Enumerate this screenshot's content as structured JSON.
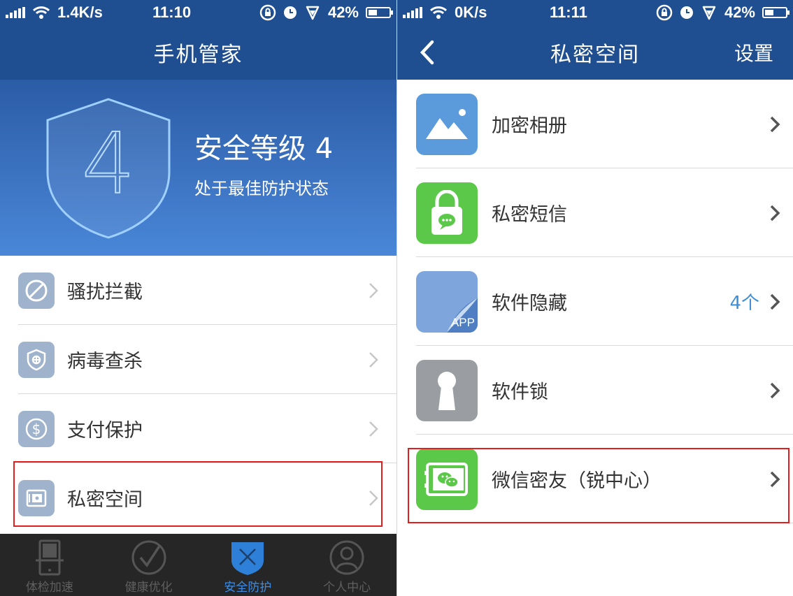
{
  "left": {
    "status": {
      "net_speed": "1.4K/s",
      "time": "11:10",
      "battery": "42%",
      "battery_level": 0.42
    },
    "nav": {
      "title": "手机管家"
    },
    "hero": {
      "digit": "4",
      "title": "安全等级 4",
      "subtitle": "处于最佳防护状态"
    },
    "items": [
      {
        "label": "骚扰拦截",
        "icon": "block-icon"
      },
      {
        "label": "病毒查杀",
        "icon": "virus-shield-icon"
      },
      {
        "label": "支付保护",
        "icon": "dollar-coin-icon"
      },
      {
        "label": "私密空间",
        "icon": "safe-box-icon",
        "highlighted": true
      }
    ],
    "tabs": [
      {
        "label": "体检加速",
        "icon": "phone-check-icon",
        "active": false
      },
      {
        "label": "健康优化",
        "icon": "checkmark-circle-icon",
        "active": false
      },
      {
        "label": "安全防护",
        "icon": "shield-x-icon",
        "active": true
      },
      {
        "label": "个人中心",
        "icon": "user-icon",
        "active": false
      }
    ]
  },
  "right": {
    "status": {
      "net_speed": "0K/s",
      "time": "11:11",
      "battery": "42%",
      "battery_level": 0.42
    },
    "nav": {
      "title": "私密空间",
      "action": "设置"
    },
    "items": [
      {
        "label": "加密相册",
        "icon": "photo-album-icon",
        "color": "#5b9bdc",
        "badge": ""
      },
      {
        "label": "私密短信",
        "icon": "lock-message-icon",
        "color": "#5cc84a",
        "badge": ""
      },
      {
        "label": "软件隐藏",
        "icon": "app-hide-icon",
        "color": "#7ea6dc",
        "badge": "4个",
        "icon_text": "APP"
      },
      {
        "label": "软件锁",
        "icon": "keyhole-icon",
        "color": "#9a9ea3",
        "badge": ""
      },
      {
        "label": "微信密友（锐中心）",
        "icon": "wechat-safe-icon",
        "color": "#5cc84a",
        "badge": "",
        "highlighted": true
      }
    ]
  },
  "colors": {
    "nav_blue": "#1f4f90",
    "highlight_red": "#e02020",
    "tab_active": "#3b8ee8",
    "badge_blue": "#3f8fd6"
  }
}
